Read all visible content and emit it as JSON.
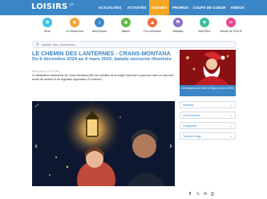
{
  "brand": {
    "logo": "LOISIRS",
    "logo_sup": ".ch"
  },
  "nav": [
    "ACTUALITÉS",
    "ACTIVITÉS",
    "AGENDA",
    "PROMOS",
    "COUPS DE COEUR",
    "VIDÉOS"
  ],
  "categories": [
    {
      "label": "Hiver",
      "color": "#3ec1e6",
      "icon": "snowflake-icon"
    },
    {
      "label": "Ce Week-end",
      "color": "#f2a23b",
      "icon": "weekend-icon"
    },
    {
      "label": "Art&Culture",
      "color": "#3b86c6",
      "icon": "art-icon"
    },
    {
      "label": "Nature",
      "color": "#6ab84c",
      "icon": "leaf-icon"
    },
    {
      "label": "Fun-Aventure",
      "color": "#f06f3a",
      "icon": "adventure-icon"
    },
    {
      "label": "Balades",
      "color": "#8d6dc9",
      "icon": "hiking-icon"
    },
    {
      "label": "Bien-Être",
      "color": "#3dbd9c",
      "icon": "wellness-icon"
    },
    {
      "label": "Moins de 10CHF",
      "color": "#e8468f",
      "icon": "price-icon"
    }
  ],
  "search": {
    "placeholder": "Activité, lieu, événement..."
  },
  "article": {
    "title": "LE CHEMIN DES LANTERNES - CRANS-MONTANA",
    "subtitle": "Du 6 décembre 2024 au 9 mars 2025, balade nocturne illuminée",
    "date": "Mis à jour le 17.10.2024",
    "description": "La destination valaisanne de Crans-Montana offre aux familles de la magie hivernale à parcourir avec un parcours bordé de lumière et de légendes régionales. En marche !"
  },
  "ad": {
    "caption": "Animations de Noël à Signy Centre 2024"
  },
  "filters": [
    "Activités",
    "Lieu/Cantons",
    "Catégories",
    "Tranche d'âge"
  ],
  "colors": {
    "primary": "#3b86c6",
    "accent": "#f5a623"
  }
}
